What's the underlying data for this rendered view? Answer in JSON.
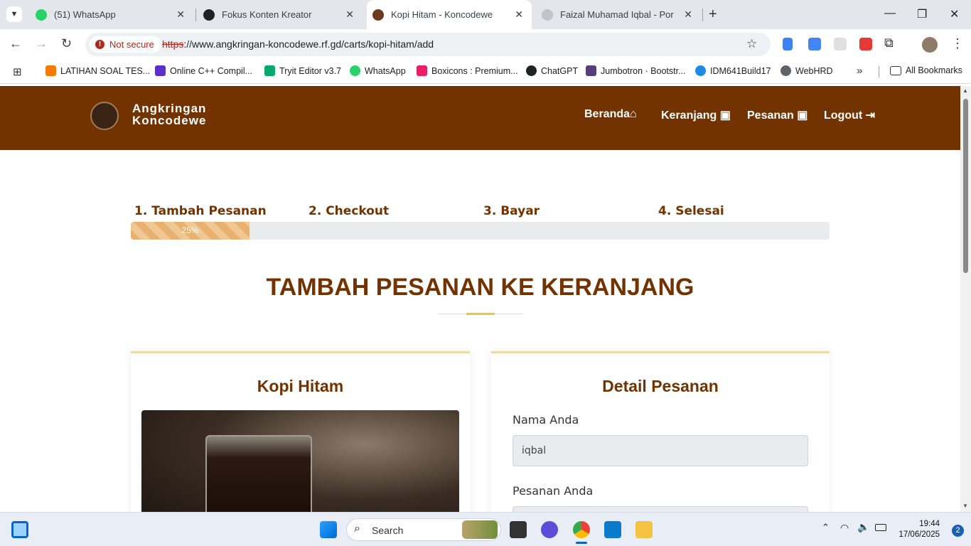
{
  "browser": {
    "tabs": [
      {
        "label": "(51) WhatsApp",
        "favicon": "whatsapp-icon",
        "color": "#25d366"
      },
      {
        "label": "Fokus Konten Kreator",
        "favicon": "openai-icon",
        "color": "#202124"
      },
      {
        "label": "Kopi Hitam - Koncodewe",
        "favicon": "coffee-logo-icon",
        "color": "#6b3a1e"
      },
      {
        "label": "Faizal Muhamad Iqbal - Portofo",
        "favicon": "site-icon",
        "color": "#c0c4c8"
      }
    ],
    "address": {
      "security_label": "Not secure",
      "scheme": "https",
      "url_rest": "://www.angkringan-koncodewe.rf.gd/carts/kopi-hitam/add"
    },
    "bookmarks": [
      {
        "label": "LATIHAN SOAL TES...",
        "color": "#f57c00"
      },
      {
        "label": "Online C++ Compil...",
        "color": "#5b2fc9"
      },
      {
        "label": "Tryit Editor v3.7",
        "color": "#04aa6d"
      },
      {
        "label": "WhatsApp",
        "color": "#25d366"
      },
      {
        "label": "Boxicons : Premium...",
        "color": "#e91e63"
      },
      {
        "label": "ChatGPT",
        "color": "#202124"
      },
      {
        "label": "Jumbotron · Bootstr...",
        "color": "#563d7c"
      },
      {
        "label": "IDM641Build17",
        "color": "#1e88e5"
      },
      {
        "label": "WebHRD",
        "color": "#5f6368"
      }
    ],
    "all_bookmarks_label": "All Bookmarks"
  },
  "site": {
    "brand_line1": "Angkringan",
    "brand_line2": "Koncodewe",
    "nav": [
      {
        "label": "Beranda",
        "icon": "home-icon"
      },
      {
        "label": "Keranjang",
        "icon": "shopping-bag-icon"
      },
      {
        "label": "Pesanan",
        "icon": "shopping-bag-icon"
      },
      {
        "label": "Logout",
        "icon": "sign-out-icon"
      }
    ],
    "accent_color": "#733300"
  },
  "steps": {
    "items": [
      "1. Tambah Pesanan",
      "2. Checkout",
      "3. Bayar",
      "4. Selesai"
    ],
    "progress_percent": 17,
    "progress_label": "25%"
  },
  "main": {
    "heading": "TAMBAH PESANAN KE KERANJANG",
    "product_title": "Kopi Hitam",
    "detail_title": "Detail Pesanan",
    "name_label": "Nama Anda",
    "name_value": "iqbal",
    "order_label": "Pesanan Anda"
  },
  "taskbar": {
    "search_label": "Search",
    "time": "19:44",
    "date": "17/06/2025",
    "notification_count": "2"
  }
}
